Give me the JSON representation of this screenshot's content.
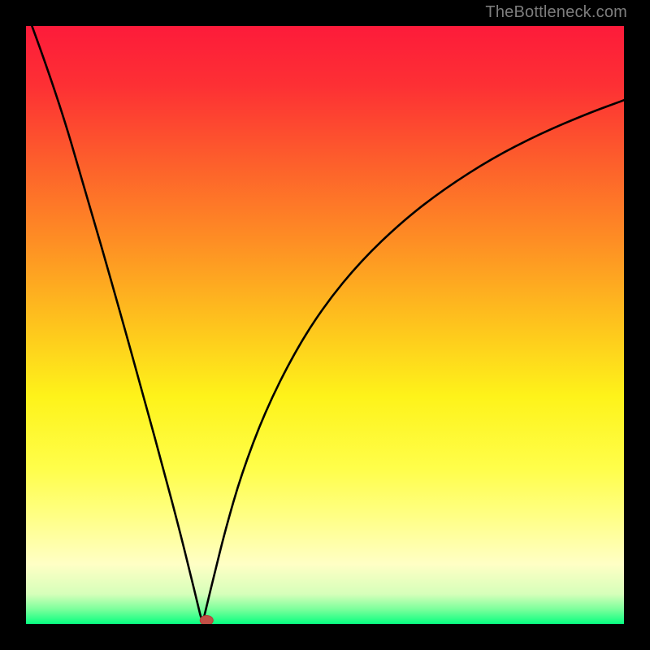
{
  "attribution": "TheBottleneck.com",
  "colors": {
    "frame": "#000000",
    "gradient_stops": [
      {
        "offset": 0.0,
        "color": "#fd1b3a"
      },
      {
        "offset": 0.1,
        "color": "#fd3034"
      },
      {
        "offset": 0.22,
        "color": "#fd5c2c"
      },
      {
        "offset": 0.36,
        "color": "#fe8e24"
      },
      {
        "offset": 0.5,
        "color": "#fec41d"
      },
      {
        "offset": 0.62,
        "color": "#fef31a"
      },
      {
        "offset": 0.74,
        "color": "#fffe4a"
      },
      {
        "offset": 0.82,
        "color": "#ffff85"
      },
      {
        "offset": 0.9,
        "color": "#ffffc5"
      },
      {
        "offset": 0.95,
        "color": "#d6ffba"
      },
      {
        "offset": 0.975,
        "color": "#7dff9c"
      },
      {
        "offset": 1.0,
        "color": "#07ff80"
      }
    ],
    "curve": "#000000",
    "marker_fill": "#c24f46",
    "marker_stroke": "#b43d38"
  },
  "chart_data": {
    "type": "line",
    "title": "",
    "xlabel": "",
    "ylabel": "",
    "xlim": [
      0,
      1
    ],
    "ylim": [
      0,
      1
    ],
    "notch_x": 0.295,
    "marker": {
      "x": 0.302,
      "y": 0.002
    },
    "series": [
      {
        "name": "curve",
        "points": [
          {
            "x": 0.01,
            "y": 1.0
          },
          {
            "x": 0.05,
            "y": 0.891
          },
          {
            "x": 0.1,
            "y": 0.722
          },
          {
            "x": 0.15,
            "y": 0.548
          },
          {
            "x": 0.2,
            "y": 0.368
          },
          {
            "x": 0.23,
            "y": 0.258
          },
          {
            "x": 0.257,
            "y": 0.156
          },
          {
            "x": 0.275,
            "y": 0.083
          },
          {
            "x": 0.287,
            "y": 0.034
          },
          {
            "x": 0.295,
            "y": 0.0
          },
          {
            "x": 0.303,
            "y": 0.034
          },
          {
            "x": 0.315,
            "y": 0.083
          },
          {
            "x": 0.333,
            "y": 0.156
          },
          {
            "x": 0.36,
            "y": 0.25
          },
          {
            "x": 0.4,
            "y": 0.356
          },
          {
            "x": 0.45,
            "y": 0.456
          },
          {
            "x": 0.5,
            "y": 0.534
          },
          {
            "x": 0.56,
            "y": 0.607
          },
          {
            "x": 0.63,
            "y": 0.674
          },
          {
            "x": 0.7,
            "y": 0.728
          },
          {
            "x": 0.78,
            "y": 0.779
          },
          {
            "x": 0.86,
            "y": 0.82
          },
          {
            "x": 0.94,
            "y": 0.854
          },
          {
            "x": 1.0,
            "y": 0.876
          }
        ]
      }
    ]
  }
}
